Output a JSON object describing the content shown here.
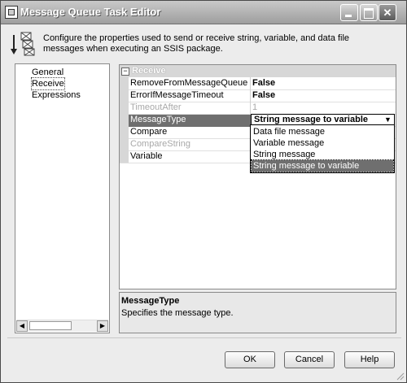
{
  "window": {
    "title": "Message Queue Task Editor"
  },
  "header": {
    "description": "Configure the properties used to send or receive string, variable, and data file messages when executing an SSIS package."
  },
  "sidebar": {
    "items": [
      {
        "label": "General"
      },
      {
        "label": "Receive"
      },
      {
        "label": "Expressions"
      }
    ],
    "selected": "Receive"
  },
  "grid": {
    "category": "Receive",
    "rows": [
      {
        "name": "RemoveFromMessageQueue",
        "value": "False"
      },
      {
        "name": "ErrorIfMessageTimeout",
        "value": "False"
      },
      {
        "name": "TimeoutAfter",
        "value": "1"
      },
      {
        "name": "MessageType",
        "value": "String message to variable"
      },
      {
        "name": "Compare",
        "value": ""
      },
      {
        "name": "CompareString",
        "value": ""
      },
      {
        "name": "Variable",
        "value": ""
      }
    ],
    "dropdown_options": [
      "Data file message",
      "Variable message",
      "String message",
      "String message to variable"
    ],
    "dropdown_selected": "String message to variable"
  },
  "description_panel": {
    "title": "MessageType",
    "text": "Specifies the message type."
  },
  "buttons": {
    "ok": "OK",
    "cancel": "Cancel",
    "help": "Help"
  }
}
